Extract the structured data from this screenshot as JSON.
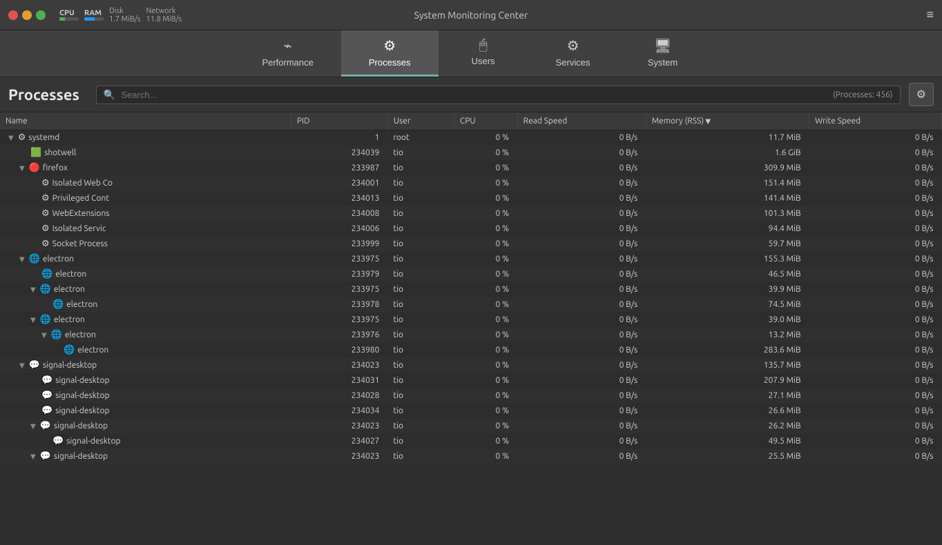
{
  "titlebar": {
    "title": "System Monitoring Center",
    "cpu_label": "CPU",
    "ram_label": "RAM",
    "disk_label": "Disk",
    "network_label": "Network",
    "disk_speed": "1.7 MiB/s",
    "network_speed": "11.8 MiB/s",
    "hamburger_label": "≡"
  },
  "nav": {
    "tabs": [
      {
        "id": "performance",
        "label": "Performance",
        "icon": "⌁"
      },
      {
        "id": "processes",
        "label": "Processes",
        "icon": "⚙"
      },
      {
        "id": "users",
        "label": "Users",
        "icon": "🖱"
      },
      {
        "id": "services",
        "label": "Services",
        "icon": "⚙"
      },
      {
        "id": "system",
        "label": "System",
        "icon": "🖥"
      }
    ],
    "active": "processes"
  },
  "header": {
    "title": "Processes",
    "search_placeholder": "Search...",
    "process_count": "(Processes: 456)"
  },
  "table": {
    "columns": [
      {
        "id": "name",
        "label": "Name"
      },
      {
        "id": "pid",
        "label": "PID"
      },
      {
        "id": "user",
        "label": "User"
      },
      {
        "id": "cpu",
        "label": "CPU"
      },
      {
        "id": "read_speed",
        "label": "Read Speed"
      },
      {
        "id": "memory",
        "label": "Memory (RSS)"
      },
      {
        "id": "write_speed",
        "label": "Write Speed"
      }
    ],
    "rows": [
      {
        "indent": 0,
        "expand": "▼",
        "icon": "⚙",
        "name": "systemd",
        "pid": "1",
        "user": "root",
        "cpu": "0 %",
        "read": "0 B/s",
        "memory": "11.7 MiB",
        "write": "0 B/s"
      },
      {
        "indent": 1,
        "expand": "",
        "icon": "🟩",
        "name": "shotwell",
        "pid": "234039",
        "user": "tio",
        "cpu": "0 %",
        "read": "0 B/s",
        "memory": "1.6 GiB",
        "write": "0 B/s"
      },
      {
        "indent": 1,
        "expand": "▼",
        "icon": "🔴",
        "name": "firefox",
        "pid": "233987",
        "user": "tio",
        "cpu": "0 %",
        "read": "0 B/s",
        "memory": "309.9 MiB",
        "write": "0 B/s"
      },
      {
        "indent": 2,
        "expand": "",
        "icon": "⚙",
        "name": "Isolated Web Co",
        "pid": "234001",
        "user": "tio",
        "cpu": "0 %",
        "read": "0 B/s",
        "memory": "151.4 MiB",
        "write": "0 B/s"
      },
      {
        "indent": 2,
        "expand": "",
        "icon": "⚙",
        "name": "Privileged Cont",
        "pid": "234013",
        "user": "tio",
        "cpu": "0 %",
        "read": "0 B/s",
        "memory": "141.4 MiB",
        "write": "0 B/s"
      },
      {
        "indent": 2,
        "expand": "",
        "icon": "⚙",
        "name": "WebExtensions",
        "pid": "234008",
        "user": "tio",
        "cpu": "0 %",
        "read": "0 B/s",
        "memory": "101.3 MiB",
        "write": "0 B/s"
      },
      {
        "indent": 2,
        "expand": "",
        "icon": "⚙",
        "name": "Isolated Servic",
        "pid": "234006",
        "user": "tio",
        "cpu": "0 %",
        "read": "0 B/s",
        "memory": "94.4 MiB",
        "write": "0 B/s"
      },
      {
        "indent": 2,
        "expand": "",
        "icon": "⚙",
        "name": "Socket Process",
        "pid": "233999",
        "user": "tio",
        "cpu": "0 %",
        "read": "0 B/s",
        "memory": "59.7 MiB",
        "write": "0 B/s"
      },
      {
        "indent": 1,
        "expand": "▼",
        "icon": "🌐",
        "name": "electron",
        "pid": "233975",
        "user": "tio",
        "cpu": "0 %",
        "read": "0 B/s",
        "memory": "155.3 MiB",
        "write": "0 B/s"
      },
      {
        "indent": 2,
        "expand": "",
        "icon": "🌐",
        "name": "electron",
        "pid": "233979",
        "user": "tio",
        "cpu": "0 %",
        "read": "0 B/s",
        "memory": "46.5 MiB",
        "write": "0 B/s"
      },
      {
        "indent": 2,
        "expand": "▼",
        "icon": "🌐",
        "name": "electron",
        "pid": "233975",
        "user": "tio",
        "cpu": "0 %",
        "read": "0 B/s",
        "memory": "39.9 MiB",
        "write": "0 B/s"
      },
      {
        "indent": 3,
        "expand": "",
        "icon": "🌐",
        "name": "electron",
        "pid": "233978",
        "user": "tio",
        "cpu": "0 %",
        "read": "0 B/s",
        "memory": "74.5 MiB",
        "write": "0 B/s"
      },
      {
        "indent": 2,
        "expand": "▼",
        "icon": "🌐",
        "name": "electron",
        "pid": "233975",
        "user": "tio",
        "cpu": "0 %",
        "read": "0 B/s",
        "memory": "39.0 MiB",
        "write": "0 B/s"
      },
      {
        "indent": 3,
        "expand": "▼",
        "icon": "🌐",
        "name": "electron",
        "pid": "233976",
        "user": "tio",
        "cpu": "0 %",
        "read": "0 B/s",
        "memory": "13.2 MiB",
        "write": "0 B/s"
      },
      {
        "indent": 4,
        "expand": "",
        "icon": "🌐",
        "name": "electron",
        "pid": "233980",
        "user": "tio",
        "cpu": "0 %",
        "read": "0 B/s",
        "memory": "283.6 MiB",
        "write": "0 B/s"
      },
      {
        "indent": 1,
        "expand": "▼",
        "icon": "💬",
        "name": "signal-desktop",
        "pid": "234023",
        "user": "tio",
        "cpu": "0 %",
        "read": "0 B/s",
        "memory": "135.7 MiB",
        "write": "0 B/s"
      },
      {
        "indent": 2,
        "expand": "",
        "icon": "💬",
        "name": "signal-desktop",
        "pid": "234031",
        "user": "tio",
        "cpu": "0 %",
        "read": "0 B/s",
        "memory": "207.9 MiB",
        "write": "0 B/s"
      },
      {
        "indent": 2,
        "expand": "",
        "icon": "💬",
        "name": "signal-desktop",
        "pid": "234028",
        "user": "tio",
        "cpu": "0 %",
        "read": "0 B/s",
        "memory": "27.1 MiB",
        "write": "0 B/s"
      },
      {
        "indent": 2,
        "expand": "",
        "icon": "💬",
        "name": "signal-desktop",
        "pid": "234034",
        "user": "tio",
        "cpu": "0 %",
        "read": "0 B/s",
        "memory": "26.6 MiB",
        "write": "0 B/s"
      },
      {
        "indent": 2,
        "expand": "▼",
        "icon": "💬",
        "name": "signal-desktop",
        "pid": "234023",
        "user": "tio",
        "cpu": "0 %",
        "read": "0 B/s",
        "memory": "26.2 MiB",
        "write": "0 B/s"
      },
      {
        "indent": 3,
        "expand": "",
        "icon": "💬",
        "name": "signal-desktop",
        "pid": "234027",
        "user": "tio",
        "cpu": "0 %",
        "read": "0 B/s",
        "memory": "49.5 MiB",
        "write": "0 B/s"
      },
      {
        "indent": 2,
        "expand": "▼",
        "icon": "💬",
        "name": "signal-desktop",
        "pid": "234023",
        "user": "tio",
        "cpu": "0 %",
        "read": "0 B/s",
        "memory": "25.5 MiB",
        "write": "0 B/s"
      }
    ]
  }
}
